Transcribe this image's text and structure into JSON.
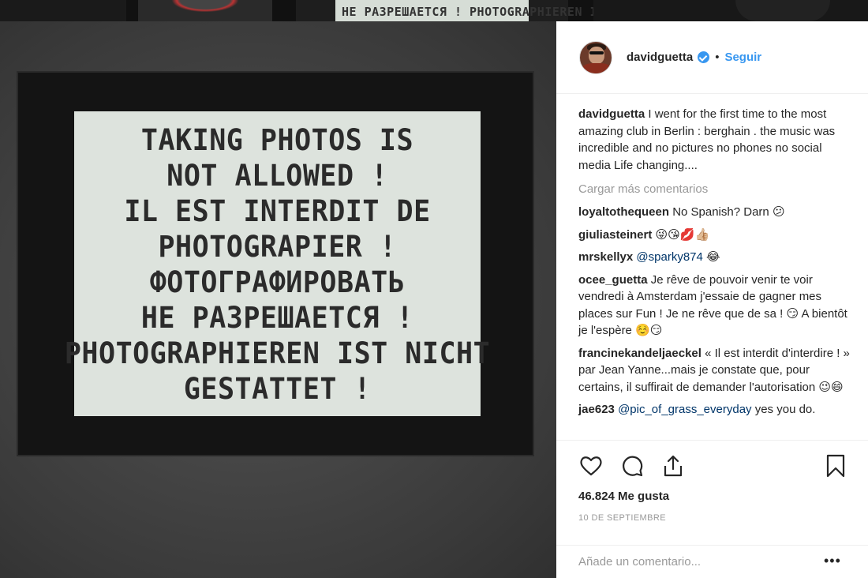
{
  "background": {
    "thumb_text": "НЕ РАЗРЕШАЕТСЯ ! PHOTOGRAPHIEREN IST NICHT"
  },
  "sign": {
    "lines": [
      "TAKING PHOTOS IS",
      "NOT ALLOWED !",
      "IL EST INTERDIT DE",
      "PHOTOGRAPIER !",
      "ФОТОГРАФИРОВАТЬ",
      "НЕ РАЗРЕШАЕТСЯ !",
      "PHOTOGRAPHIEREN IST NICHT",
      "GESTATTET !"
    ]
  },
  "header": {
    "username": "davidguetta",
    "separator": "•",
    "follow_label": "Seguir"
  },
  "caption": {
    "user": "davidguetta",
    "text": "I went for the first time to the most amazing club in Berlin : berghain . the music was incredible and no pictures no phones no social media Life changing...."
  },
  "load_more": "Cargar más comentarios",
  "comments": [
    {
      "user": "loyaltothequeen",
      "text": "No Spanish? Darn ",
      "emoji": "😕"
    },
    {
      "user": "giuliasteinert",
      "text": "",
      "emoji": "😜😘💋👍🏼"
    },
    {
      "user": "mrskellyx",
      "mention": "@sparky874",
      "text": " ",
      "emoji": "😂"
    },
    {
      "user": "ocee_guetta",
      "text": "Je rêve de pouvoir venir te voir vendredi à Amsterdam j'essaie de gagner mes places sur Fun ! Je ne rêve que de sa ! ",
      "emoji_mid": "😏",
      "text2": " A bientôt je l'espère ",
      "emoji": "☺️😏"
    },
    {
      "user": "francinekandeljaeckel",
      "text": "« Il est interdit d'interdire ! » par Jean Yanne...mais je constate que, pour certains, il suffirait de demander l'autorisation ",
      "emoji": "😉😄"
    },
    {
      "user": "jae623",
      "mention": "@pic_of_grass_everyday",
      "text": " yes you do.",
      "emoji": ""
    }
  ],
  "likes": "46.824 Me gusta",
  "date": "10 DE SEPTIEMBRE",
  "add_comment": {
    "placeholder": "Añade un comentario..."
  },
  "more_label": "•••",
  "colors": {
    "link_blue": "#3897f0",
    "mention_blue": "#003569",
    "text": "#262626",
    "muted": "#999999"
  }
}
